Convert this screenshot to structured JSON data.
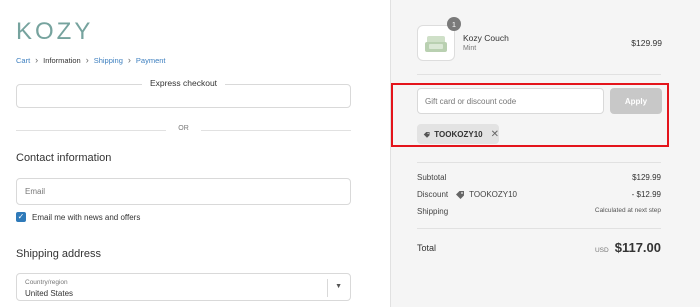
{
  "brand": {
    "logo": "KOZY"
  },
  "breadcrumb": {
    "items": [
      {
        "label": "Cart",
        "state": "link"
      },
      {
        "label": "Information",
        "state": "current"
      },
      {
        "label": "Shipping",
        "state": "link"
      },
      {
        "label": "Payment",
        "state": "link"
      }
    ]
  },
  "express": {
    "title": "Express checkout"
  },
  "divider": {
    "or": "OR"
  },
  "contact": {
    "title": "Contact information",
    "email_placeholder": "Email",
    "newsletter_label": "Email me with news and offers",
    "newsletter_checked": true
  },
  "shipping": {
    "title": "Shipping address",
    "country_label": "Country/region",
    "country_value": "United States"
  },
  "order": {
    "product": {
      "name": "Kozy Couch",
      "variant": "Mint",
      "price": "$129.99",
      "quantity": "1"
    },
    "discount_placeholder": "Gift card or discount code",
    "apply_label": "Apply",
    "applied_code": "TOOKOZY10",
    "subtotal_label": "Subtotal",
    "subtotal_value": "$129.99",
    "discount_label": "Discount",
    "discount_code": "TOOKOZY10",
    "discount_value": "- $12.99",
    "shipping_label": "Shipping",
    "shipping_value": "Calculated at next step",
    "total_label": "Total",
    "currency": "USD",
    "total_value": "$117.00"
  },
  "colors": {
    "accent": "#2f7ab9",
    "logo": "#76a39e",
    "highlight": "#e4141b",
    "link": "#3d7fbf"
  }
}
